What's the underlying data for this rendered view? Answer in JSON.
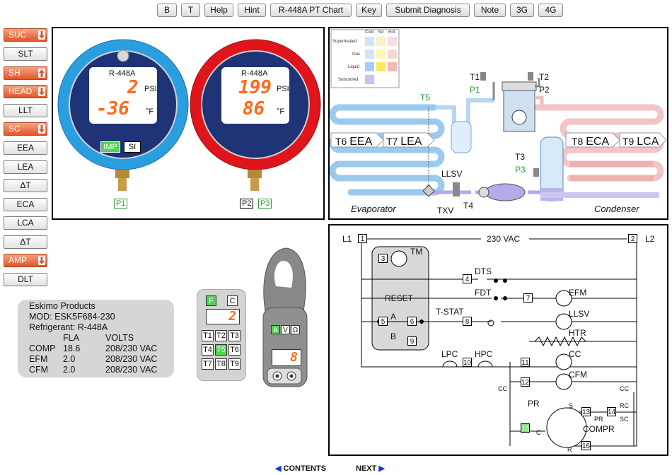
{
  "toolbar": {
    "buttons": [
      "B",
      "T",
      "Help",
      "Hint",
      "R-448A PT Chart",
      "Key",
      "Submit Diagnosis",
      "Note",
      "3G",
      "4G"
    ]
  },
  "sidebar": {
    "items": [
      {
        "label": "SUC",
        "hot": true,
        "arrow": "down"
      },
      {
        "label": "SLT",
        "hot": false
      },
      {
        "label": "SH",
        "hot": true,
        "arrow": "up"
      },
      {
        "label": "HEAD",
        "hot": true,
        "arrow": "down"
      },
      {
        "label": "LLT",
        "hot": false
      },
      {
        "label": "SC",
        "hot": true,
        "arrow": "down"
      },
      {
        "label": "EEA",
        "hot": false
      },
      {
        "label": "LEA",
        "hot": false
      },
      {
        "label": "ΔT",
        "hot": false
      },
      {
        "label": "ECA",
        "hot": false
      },
      {
        "label": "LCA",
        "hot": false
      },
      {
        "label": "ΔT",
        "hot": false
      },
      {
        "label": "AMP",
        "hot": true,
        "arrow": "down"
      },
      {
        "label": "DLT",
        "hot": false
      }
    ]
  },
  "gauges": {
    "low": {
      "refrigerant": "R-448A",
      "pressure": "2",
      "pressure_unit": "PSI",
      "temp": "-36",
      "temp_unit": "°F",
      "imp": "IMP",
      "si": "SI",
      "port": "P1",
      "color": "#2a9fe0"
    },
    "high": {
      "refrigerant": "R-448A",
      "pressure": "199",
      "pressure_unit": "PSI",
      "temp": "86",
      "temp_unit": "°F",
      "port_a": "P2",
      "port_b": "P3",
      "color": "#e0141b"
    }
  },
  "legend": {
    "cols": [
      "Cold",
      "Yel",
      "Hot"
    ],
    "rows": [
      "Superheated",
      "Gas",
      "Liquid",
      "Subcooled"
    ]
  },
  "system": {
    "t1": "T1",
    "p1": "P1",
    "t2": "T2",
    "p2": "P2",
    "t3": "T3",
    "p3": "P3",
    "t5": "T5",
    "t4": "T4",
    "t6": "T6",
    "eea": "EEA",
    "t7": "T7",
    "lea": "LEA",
    "t8": "T8",
    "eca": "ECA",
    "t9": "T9",
    "lca": "LCA",
    "llsv": "LLSV",
    "txv": "TXV",
    "evaporator": "Evaporator",
    "condenser": "Condenser"
  },
  "info": {
    "maker": "Eskimo Products",
    "model": "MOD:  ESK5F684-230",
    "refrigerant": "Refrigerant: R-448A",
    "head_fla": "FLA",
    "head_volts": "VOLTS",
    "rows": [
      {
        "name": "COMP",
        "fla": "18.6",
        "volts": "208/230 VAC"
      },
      {
        "name": "EFM",
        "fla": "2.0",
        "volts": "208/230 VAC"
      },
      {
        "name": "CFM",
        "fla": "2.0",
        "volts": "208/230 VAC"
      }
    ]
  },
  "thermometer": {
    "f": "F",
    "c": "C",
    "reading": "2",
    "buttons": [
      "T1",
      "T2",
      "T3",
      "T4",
      "T5",
      "T6",
      "T7",
      "T8",
      "T9"
    ],
    "active": "T5"
  },
  "clamp": {
    "a": "A",
    "v": "V",
    "ohm": "Ω",
    "reading": "8"
  },
  "wiring": {
    "l1": "L1",
    "l2": "L2",
    "voltage": "230 VAC",
    "tm": "TM",
    "reset": "RESET",
    "dts": "DTS",
    "fdt": "FDT",
    "efm": "EFM",
    "tstat": "T-STAT",
    "llsv": "LLSV",
    "htr": "HTR",
    "a": "A",
    "b": "B",
    "lpc": "LPC",
    "hpc": "HPC",
    "cc": "CC",
    "cfm": "CFM",
    "cc_left": "CC",
    "cc_right": "CC",
    "rc": "RC",
    "sc": "SC",
    "pr": "PR",
    "pr2": "PR",
    "compr": "COMPR",
    "s": "S",
    "c": "C",
    "r": "R",
    "terminals": [
      "1",
      "2",
      "3",
      "4",
      "5",
      "6",
      "7",
      "8",
      "9",
      "10",
      "11",
      "12",
      "13",
      "14",
      "15",
      "16"
    ]
  },
  "nav": {
    "contents": "CONTENTS",
    "next": "NEXT"
  }
}
